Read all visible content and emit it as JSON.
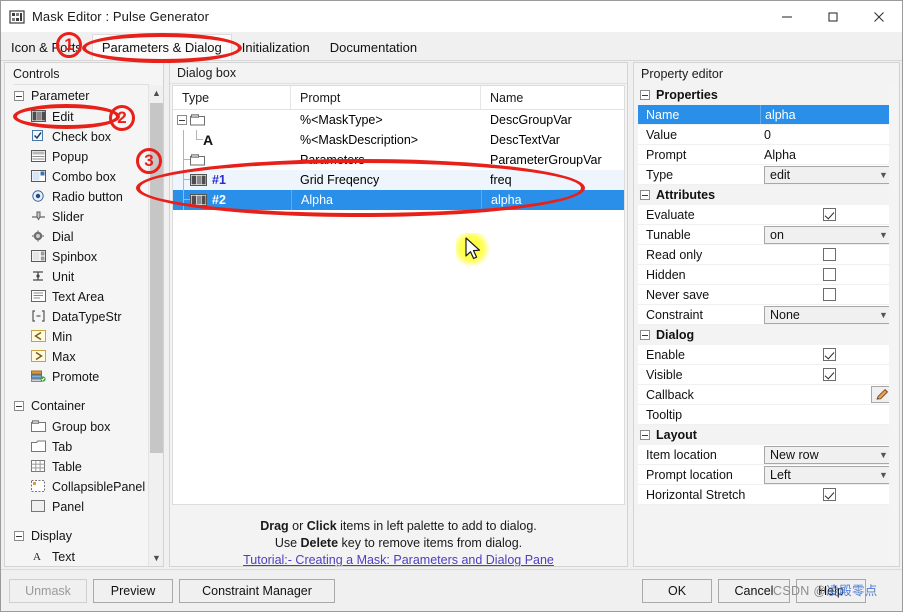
{
  "window": {
    "title": "Mask Editor : Pulse Generator",
    "icon": "mask-editor-icon",
    "buttons": {
      "minimize": "minimize-icon",
      "maximize": "maximize-icon",
      "close": "close-icon"
    }
  },
  "tabs": [
    {
      "label": "Icon & Ports",
      "active": false
    },
    {
      "label": "Parameters & Dialog",
      "active": true
    },
    {
      "label": "Initialization",
      "active": false
    },
    {
      "label": "Documentation",
      "active": false
    }
  ],
  "controls_panel": {
    "header": "Controls",
    "groups": [
      {
        "label": "Parameter",
        "items": [
          {
            "label": "Edit",
            "icon": "edit-field-icon"
          },
          {
            "label": "Check box",
            "icon": "checkbox-icon"
          },
          {
            "label": "Popup",
            "icon": "popup-icon"
          },
          {
            "label": "Combo box",
            "icon": "combobox-icon"
          },
          {
            "label": "Radio button",
            "icon": "radio-button-icon"
          },
          {
            "label": "Slider",
            "icon": "slider-icon"
          },
          {
            "label": "Dial",
            "icon": "dial-icon"
          },
          {
            "label": "Spinbox",
            "icon": "spinbox-icon"
          },
          {
            "label": "Unit",
            "icon": "unit-icon"
          },
          {
            "label": "Text Area",
            "icon": "text-area-icon"
          },
          {
            "label": "DataTypeStr",
            "icon": "datatypestr-icon"
          },
          {
            "label": "Min",
            "icon": "min-icon"
          },
          {
            "label": "Max",
            "icon": "max-icon"
          },
          {
            "label": "Promote",
            "icon": "promote-icon"
          }
        ]
      },
      {
        "label": "Container",
        "items": [
          {
            "label": "Group box",
            "icon": "group-box-icon"
          },
          {
            "label": "Tab",
            "icon": "tab-icon"
          },
          {
            "label": "Table",
            "icon": "table-icon"
          },
          {
            "label": "CollapsiblePanel",
            "icon": "collapsible-panel-icon"
          },
          {
            "label": "Panel",
            "icon": "panel-icon"
          }
        ]
      },
      {
        "label": "Display",
        "items": [
          {
            "label": "Text",
            "icon": "text-icon"
          }
        ]
      }
    ]
  },
  "dialog_box": {
    "header": "Dialog box",
    "columns": [
      "Type",
      "Prompt",
      "Name"
    ],
    "rows": [
      {
        "type": "",
        "prompt": "%<MaskType>",
        "name": "DescGroupVar",
        "icon": "group-icon",
        "indent": 0,
        "expander": true,
        "selected": false,
        "alt": false
      },
      {
        "type": "",
        "prompt": "%<MaskDescription>",
        "name": "DescTextVar",
        "icon": "text-a-icon",
        "indent": 1,
        "expander": false,
        "selected": false,
        "alt": false
      },
      {
        "type": "",
        "prompt": "Parameters",
        "name": "ParameterGroupVar",
        "icon": "group-icon",
        "indent": 0,
        "expander": false,
        "selected": false,
        "alt": false
      },
      {
        "type": "#1",
        "prompt": "Grid Freqency",
        "name": "freq",
        "icon": "edit-field-icon",
        "indent": 0,
        "expander": false,
        "selected": false,
        "alt": true
      },
      {
        "type": "#2",
        "prompt": "Alpha",
        "name": "alpha",
        "icon": "edit-field-icon",
        "indent": 0,
        "expander": false,
        "selected": true,
        "alt": false
      }
    ],
    "hints": {
      "line1_a": "Drag",
      "line1_b": " or ",
      "line1_c": "Click",
      "line1_d": " items in left palette to add to dialog.",
      "line2_a": "Use ",
      "line2_b": "Delete",
      "line2_c": " key to remove items from dialog.",
      "tutorial_link": "Tutorial:- Creating a Mask: Parameters and Dialog Pane"
    }
  },
  "property_editor": {
    "header": "Property editor",
    "sections": [
      {
        "label": "Properties",
        "rows": [
          {
            "label": "Name",
            "value": "alpha",
            "kind": "text",
            "selected": true
          },
          {
            "label": "Value",
            "value": "0",
            "kind": "text",
            "selected": false
          },
          {
            "label": "Prompt",
            "value": "Alpha",
            "kind": "text",
            "selected": false
          },
          {
            "label": "Type",
            "value": "edit",
            "kind": "combo",
            "selected": false
          }
        ]
      },
      {
        "label": "Attributes",
        "rows": [
          {
            "label": "Evaluate",
            "value": "",
            "kind": "checkbox",
            "checked": true
          },
          {
            "label": "Tunable",
            "value": "on",
            "kind": "combo"
          },
          {
            "label": "Read only",
            "value": "",
            "kind": "checkbox",
            "checked": false
          },
          {
            "label": "Hidden",
            "value": "",
            "kind": "checkbox",
            "checked": false
          },
          {
            "label": "Never save",
            "value": "",
            "kind": "checkbox",
            "checked": false
          },
          {
            "label": "Constraint",
            "value": "None",
            "kind": "combo"
          }
        ]
      },
      {
        "label": "Dialog",
        "rows": [
          {
            "label": "Enable",
            "value": "",
            "kind": "checkbox",
            "checked": true
          },
          {
            "label": "Visible",
            "value": "",
            "kind": "checkbox",
            "checked": true
          },
          {
            "label": "Callback",
            "value": "",
            "kind": "pencil"
          },
          {
            "label": "Tooltip",
            "value": "",
            "kind": "text"
          }
        ]
      },
      {
        "label": "Layout",
        "rows": [
          {
            "label": "Item location",
            "value": "New row",
            "kind": "combo"
          },
          {
            "label": "Prompt location",
            "value": "Left",
            "kind": "combo"
          },
          {
            "label": "Horizontal Stretch",
            "value": "",
            "kind": "checkbox",
            "checked": true
          }
        ]
      }
    ]
  },
  "footer": {
    "unmask": "Unmask",
    "preview": "Preview",
    "constraint_manager": "Constraint Manager",
    "ok": "OK",
    "cancel": "Cancel",
    "help": "Help"
  },
  "annotations": [
    {
      "id": "1",
      "target": "tab-parameters-and-dialog"
    },
    {
      "id": "2",
      "target": "control-edit"
    },
    {
      "id": "3",
      "target": "parameter-rows"
    }
  ],
  "watermark": {
    "prefix": "CSDN @",
    "name": "凌殿零点"
  },
  "colors": {
    "selection_blue": "#2a8fe8",
    "annotation_red": "#e8201a",
    "link_purple": "#4b3fbe",
    "alt_row": "#eef5fd",
    "cursor_glow": "#ffff3a"
  }
}
